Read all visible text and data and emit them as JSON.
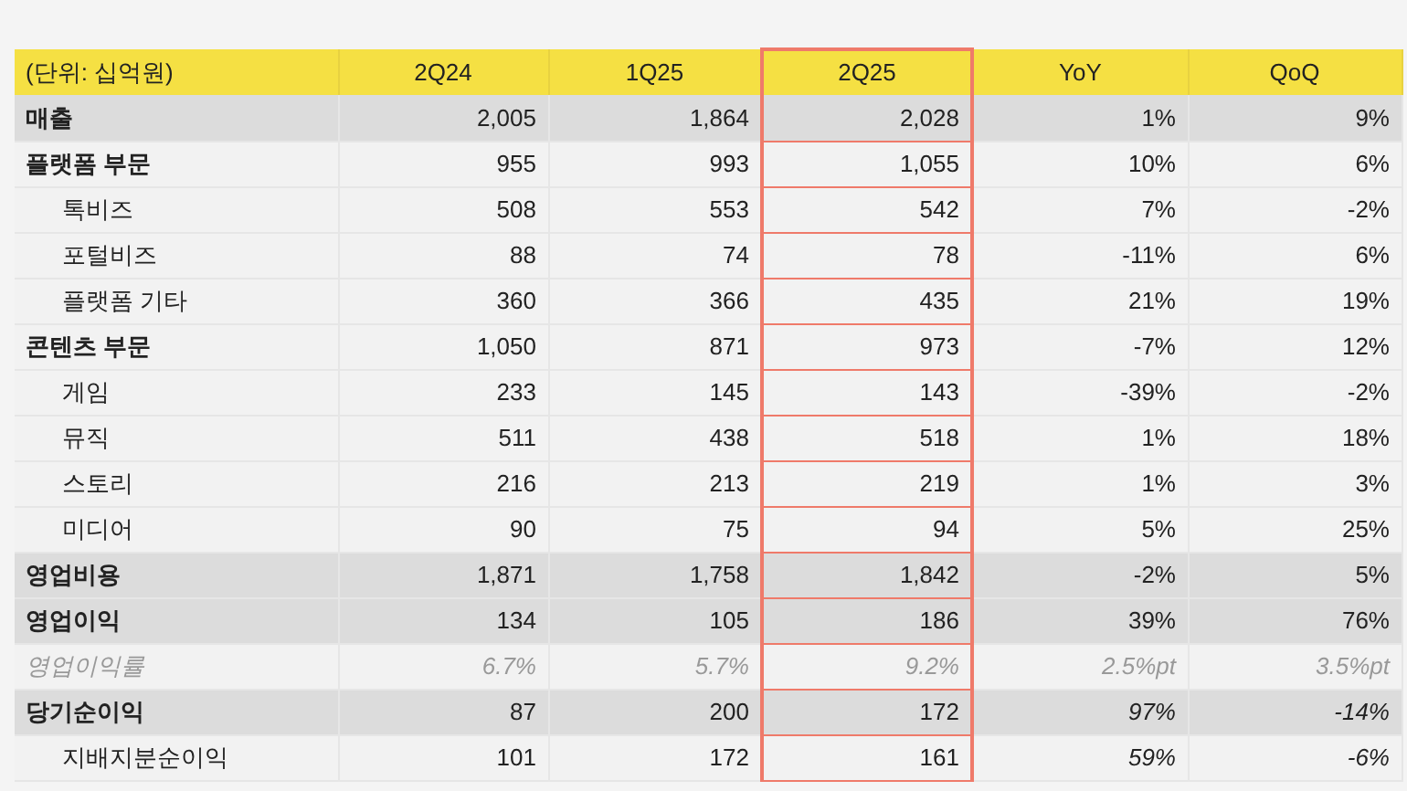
{
  "table": {
    "columns": [
      {
        "label": "(단위: 십억원)",
        "highlighted": false
      },
      {
        "label": "2Q24",
        "highlighted": false
      },
      {
        "label": "1Q25",
        "highlighted": false
      },
      {
        "label": "2Q25",
        "highlighted": true
      },
      {
        "label": "YoY",
        "highlighted": false
      },
      {
        "label": "QoQ",
        "highlighted": false
      }
    ],
    "rows": [
      {
        "kind": "total",
        "italic_change": false,
        "cells": [
          "매출",
          "2,005",
          "1,864",
          "2,028",
          "1%",
          "9%"
        ]
      },
      {
        "kind": "segment",
        "italic_change": false,
        "cells": [
          "플랫폼 부문",
          "955",
          "993",
          "1,055",
          "10%",
          "6%"
        ]
      },
      {
        "kind": "sub",
        "italic_change": false,
        "cells": [
          "톡비즈",
          "508",
          "553",
          "542",
          "7%",
          "-2%"
        ]
      },
      {
        "kind": "sub",
        "italic_change": false,
        "cells": [
          "포털비즈",
          "88",
          "74",
          "78",
          "-11%",
          "6%"
        ]
      },
      {
        "kind": "sub",
        "italic_change": false,
        "cells": [
          "플랫폼 기타",
          "360",
          "366",
          "435",
          "21%",
          "19%"
        ]
      },
      {
        "kind": "segment",
        "italic_change": false,
        "cells": [
          "콘텐츠 부문",
          "1,050",
          "871",
          "973",
          "-7%",
          "12%"
        ]
      },
      {
        "kind": "sub",
        "italic_change": false,
        "cells": [
          "게임",
          "233",
          "145",
          "143",
          "-39%",
          "-2%"
        ]
      },
      {
        "kind": "sub",
        "italic_change": false,
        "cells": [
          "뮤직",
          "511",
          "438",
          "518",
          "1%",
          "18%"
        ]
      },
      {
        "kind": "sub",
        "italic_change": false,
        "cells": [
          "스토리",
          "216",
          "213",
          "219",
          "1%",
          "3%"
        ]
      },
      {
        "kind": "sub",
        "italic_change": false,
        "cells": [
          "미디어",
          "90",
          "75",
          "94",
          "5%",
          "25%"
        ]
      },
      {
        "kind": "total",
        "italic_change": false,
        "cells": [
          "영업비용",
          "1,871",
          "1,758",
          "1,842",
          "-2%",
          "5%"
        ]
      },
      {
        "kind": "total",
        "italic_change": false,
        "cells": [
          "영업이익",
          "134",
          "105",
          "186",
          "39%",
          "76%"
        ]
      },
      {
        "kind": "ratio",
        "italic_change": true,
        "cells": [
          "영업이익률",
          "6.7%",
          "5.7%",
          "9.2%",
          "2.5%pt",
          "3.5%pt"
        ]
      },
      {
        "kind": "total",
        "italic_change": true,
        "cells": [
          "당기순이익",
          "87",
          "200",
          "172",
          "97%",
          "-14%"
        ]
      },
      {
        "kind": "sub",
        "italic_change": true,
        "cells": [
          "지배지분순이익",
          "101",
          "172",
          "161",
          "59%",
          "-6%"
        ]
      }
    ]
  }
}
